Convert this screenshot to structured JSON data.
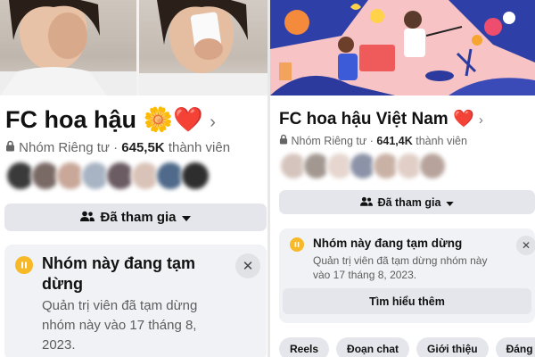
{
  "left": {
    "group_name": "FC hoa hậu",
    "title_emojis": "🌼❤️",
    "chevron": "›",
    "privacy_label": "Nhóm Riêng tư",
    "separator": "·",
    "member_count": "645,5K",
    "member_suffix": "thành viên",
    "joined_label": "Đã tham gia",
    "notice": {
      "title": "Nhóm này đang tạm dừng",
      "body": "Quản trị viên đã tạm dừng nhóm này vào 17 tháng 8, 2023.",
      "close": "✕"
    }
  },
  "right": {
    "group_name": "FC hoa hậu Việt Nam",
    "title_emojis": "❤️",
    "chevron": "›",
    "privacy_label": "Nhóm Riêng tư",
    "separator": "·",
    "member_count": "641,4K",
    "member_suffix": "thành viên",
    "joined_label": "Đã tham gia",
    "notice": {
      "title": "Nhóm này đang tạm dừng",
      "body": "Quản trị viên đã tạm dừng nhóm này vào 17 tháng 8, 2023.",
      "close": "✕",
      "learn_more": "Tìm hiểu thêm"
    },
    "tabs": [
      "Reels",
      "Đoạn chat",
      "Giới thiệu",
      "Đáng chú ý"
    ]
  },
  "colors": {
    "pause_icon": "#f7b928",
    "button_bg": "#e4e6eb",
    "notice_bg": "#f0f2f5",
    "heart": "#e0245e"
  },
  "icons": [
    "lock-icon",
    "people-icon",
    "caret-down-icon",
    "pause-icon",
    "close-icon",
    "chevron-right-icon"
  ]
}
